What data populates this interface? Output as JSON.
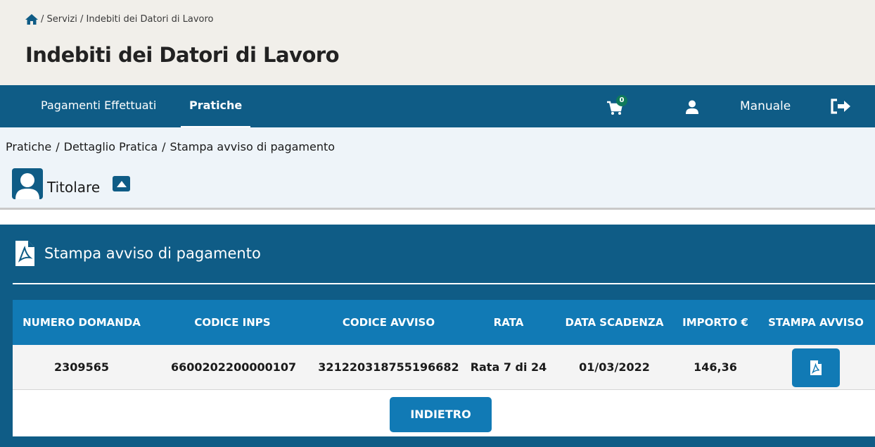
{
  "header": {
    "breadcrumb": "/ Servizi / Indebiti dei Datori di Lavoro",
    "title": "Indebiti dei Datori di Lavoro"
  },
  "nav": {
    "items": [
      {
        "label": "Pagamenti Effettuati"
      },
      {
        "label": "Pratiche",
        "active": true
      }
    ],
    "cart_count": "0",
    "manuale": "Manuale"
  },
  "subbar": {
    "breadcrumb": [
      "Pratiche",
      "Dettaglio Pratica",
      "Stampa avviso di pagamento"
    ],
    "separator": "/",
    "titolare": "Titolare"
  },
  "panel": {
    "title": "Stampa avviso di pagamento",
    "columns": [
      "NUMERO DOMANDA",
      "CODICE INPS",
      "CODICE AVVISO",
      "RATA",
      "DATA SCADENZA",
      "IMPORTO €",
      "STAMPA AVVISO"
    ],
    "rows": [
      {
        "numero_domanda": "2309565",
        "codice_inps": "6600202200000107",
        "codice_avviso": "321220318755196682",
        "rata": "Rata 7 di 24",
        "data_scadenza": "01/03/2022",
        "importo": "146,36"
      }
    ],
    "back_button": "INDIETRO"
  },
  "colors": {
    "header_bg": "#f1efea",
    "nav_bg": "#0f5c86",
    "table_header_bg": "#117ab5",
    "subbar_bg": "#eef4f9"
  }
}
